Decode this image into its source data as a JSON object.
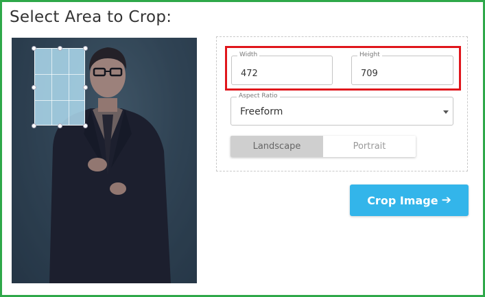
{
  "title": "Select Area to Crop:",
  "crop_settings": {
    "width": {
      "label": "Width",
      "value": "472"
    },
    "height": {
      "label": "Height",
      "value": "709"
    },
    "aspect_ratio": {
      "label": "Aspect Ratio",
      "selected": "Freeform"
    },
    "orientation": {
      "options": [
        "Landscape",
        "Portrait"
      ],
      "selected": "Landscape"
    }
  },
  "crop_button": {
    "label": "Crop Image",
    "icon": "arrow-right-icon"
  },
  "colors": {
    "frame": "#2ea84a",
    "highlight": "#e0151b",
    "accent": "#33b5ea"
  }
}
